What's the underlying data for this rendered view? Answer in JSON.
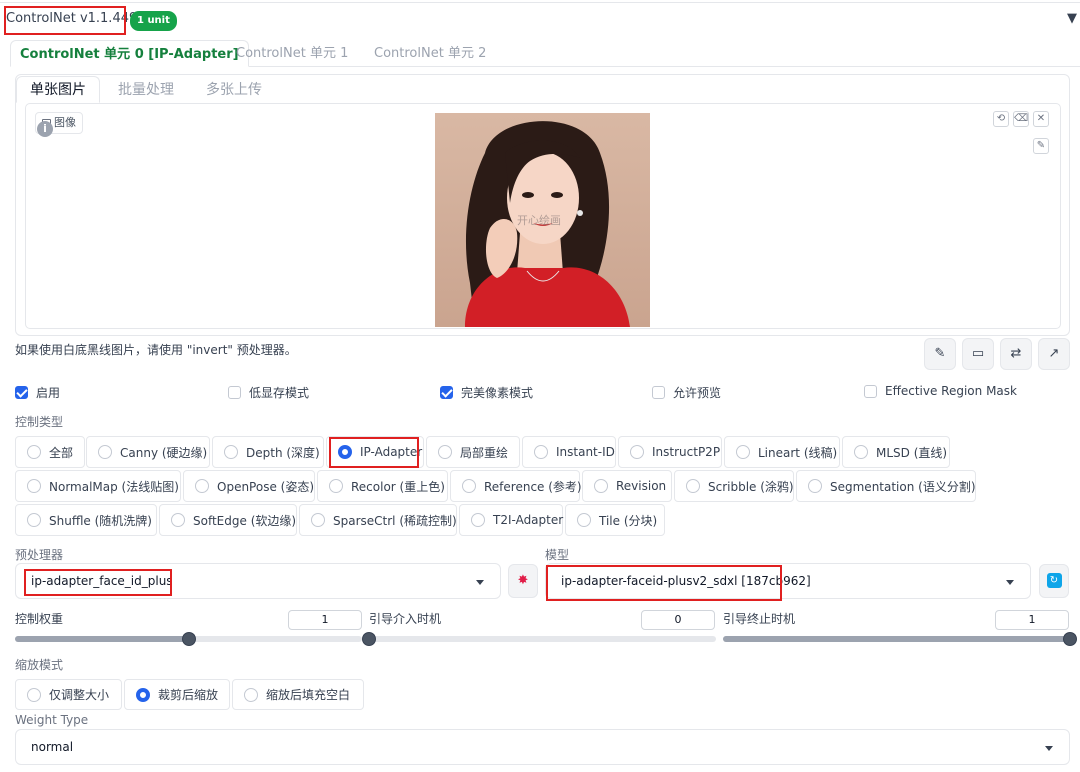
{
  "header": {
    "title": "ControlNet v1.1.449",
    "badge": "1 unit",
    "collapse_icon": "triangle-down-icon"
  },
  "unit_tabs": [
    {
      "label": "ControlNet 单元 0 [IP-Adapter]",
      "active": true
    },
    {
      "label": "ControlNet 单元 1",
      "active": false
    },
    {
      "label": "ControlNet 单元 2",
      "active": false
    }
  ],
  "image_tabs": [
    {
      "label": "单张图片",
      "active": true
    },
    {
      "label": "批量处理",
      "active": false
    },
    {
      "label": "多张上传",
      "active": false
    }
  ],
  "image_panel": {
    "label": "图像",
    "watermark": "开心绘画",
    "hint": "如果使用白底黑线图片，请使用 \"invert\" 预处理器。"
  },
  "options": [
    {
      "label": "启用",
      "checked": true
    },
    {
      "label": "低显存模式",
      "checked": false
    },
    {
      "label": "完美像素模式",
      "checked": true
    },
    {
      "label": "允许预览",
      "checked": false
    },
    {
      "label": "Effective Region Mask",
      "checked": false
    }
  ],
  "control_type": {
    "label": "控制类型",
    "items": [
      {
        "label": "全部",
        "selected": false
      },
      {
        "label": "Canny (硬边缘)",
        "selected": false
      },
      {
        "label": "Depth (深度)",
        "selected": false
      },
      {
        "label": "IP-Adapter",
        "selected": true
      },
      {
        "label": "局部重绘",
        "selected": false
      },
      {
        "label": "Instant-ID",
        "selected": false
      },
      {
        "label": "InstructP2P",
        "selected": false
      },
      {
        "label": "Lineart (线稿)",
        "selected": false
      },
      {
        "label": "MLSD (直线)",
        "selected": false
      },
      {
        "label": "NormalMap (法线贴图)",
        "selected": false
      },
      {
        "label": "OpenPose (姿态)",
        "selected": false
      },
      {
        "label": "Recolor (重上色)",
        "selected": false
      },
      {
        "label": "Reference (参考)",
        "selected": false
      },
      {
        "label": "Revision",
        "selected": false
      },
      {
        "label": "Scribble (涂鸦)",
        "selected": false
      },
      {
        "label": "Segmentation (语义分割)",
        "selected": false
      },
      {
        "label": "Shuffle (随机洗牌)",
        "selected": false
      },
      {
        "label": "SoftEdge (软边缘)",
        "selected": false
      },
      {
        "label": "SparseCtrl (稀疏控制)",
        "selected": false
      },
      {
        "label": "T2I-Adapter",
        "selected": false
      },
      {
        "label": "Tile (分块)",
        "selected": false
      }
    ]
  },
  "preprocessor": {
    "label": "预处理器",
    "value": "ip-adapter_face_id_plus"
  },
  "model": {
    "label": "模型",
    "value": "ip-adapter-faceid-plusv2_sdxl [187cb962]"
  },
  "sliders": [
    {
      "label": "控制权重",
      "value": "1",
      "fraction": 0.5
    },
    {
      "label": "引导介入时机",
      "value": "0",
      "fraction": 0.0
    },
    {
      "label": "引导终止时机",
      "value": "1",
      "fraction": 1.0
    }
  ],
  "resize_mode": {
    "label": "缩放模式",
    "items": [
      {
        "label": "仅调整大小",
        "selected": false
      },
      {
        "label": "裁剪后缩放",
        "selected": true
      },
      {
        "label": "缩放后填充空白",
        "selected": false
      }
    ]
  },
  "weight_type": {
    "label": "Weight Type",
    "value": "normal"
  },
  "colors": {
    "accent": "#2563eb",
    "active_tab": "#15803d",
    "badge": "#16a34a",
    "highlight": "#e02020"
  }
}
